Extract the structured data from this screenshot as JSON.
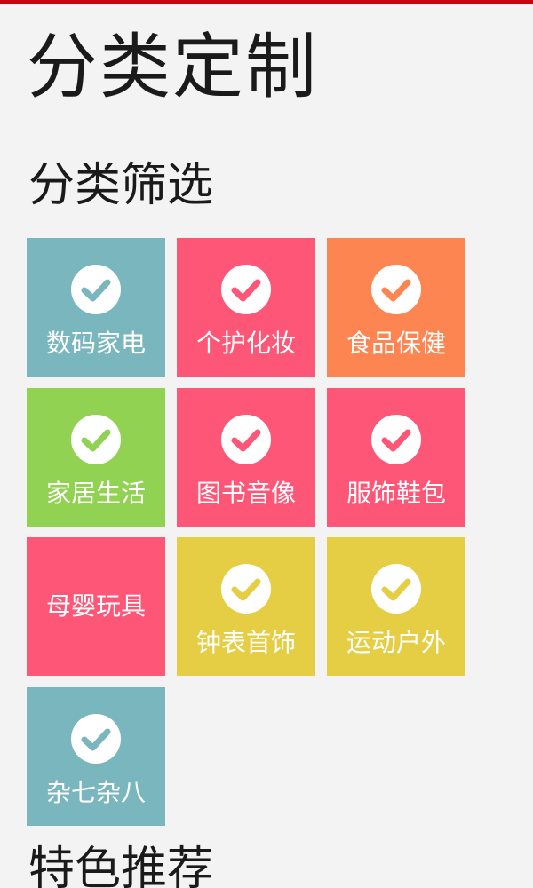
{
  "page": {
    "title": "分类定制",
    "accent_color": "#c8060e",
    "background_color": "#f3f3f3"
  },
  "filter_section": {
    "title": "分类筛选"
  },
  "categories": [
    {
      "label": "数码家电",
      "color": "#7ab6be",
      "checked": true,
      "icon": "check-circle-icon"
    },
    {
      "label": "个护化妆",
      "color": "#fe5677",
      "checked": true,
      "icon": "check-circle-icon"
    },
    {
      "label": "食品保健",
      "color": "#fd8551",
      "checked": true,
      "icon": "check-circle-icon"
    },
    {
      "label": "家居生活",
      "color": "#91d253",
      "checked": true,
      "icon": "check-circle-icon"
    },
    {
      "label": "图书音像",
      "color": "#fe5677",
      "checked": true,
      "icon": "check-circle-icon"
    },
    {
      "label": "服饰鞋包",
      "color": "#fe5677",
      "checked": true,
      "icon": "check-circle-icon"
    },
    {
      "label": "母婴玩具",
      "color": "#fe5677",
      "checked": false,
      "icon": ""
    },
    {
      "label": "钟表首饰",
      "color": "#e5ce43",
      "checked": true,
      "icon": "check-circle-icon"
    },
    {
      "label": "运动户外",
      "color": "#e5ce43",
      "checked": true,
      "icon": "check-circle-icon"
    },
    {
      "label": "杂七杂八",
      "color": "#7ab6be",
      "checked": true,
      "icon": "check-circle-icon"
    }
  ],
  "featured_section": {
    "title": "特色推荐"
  }
}
